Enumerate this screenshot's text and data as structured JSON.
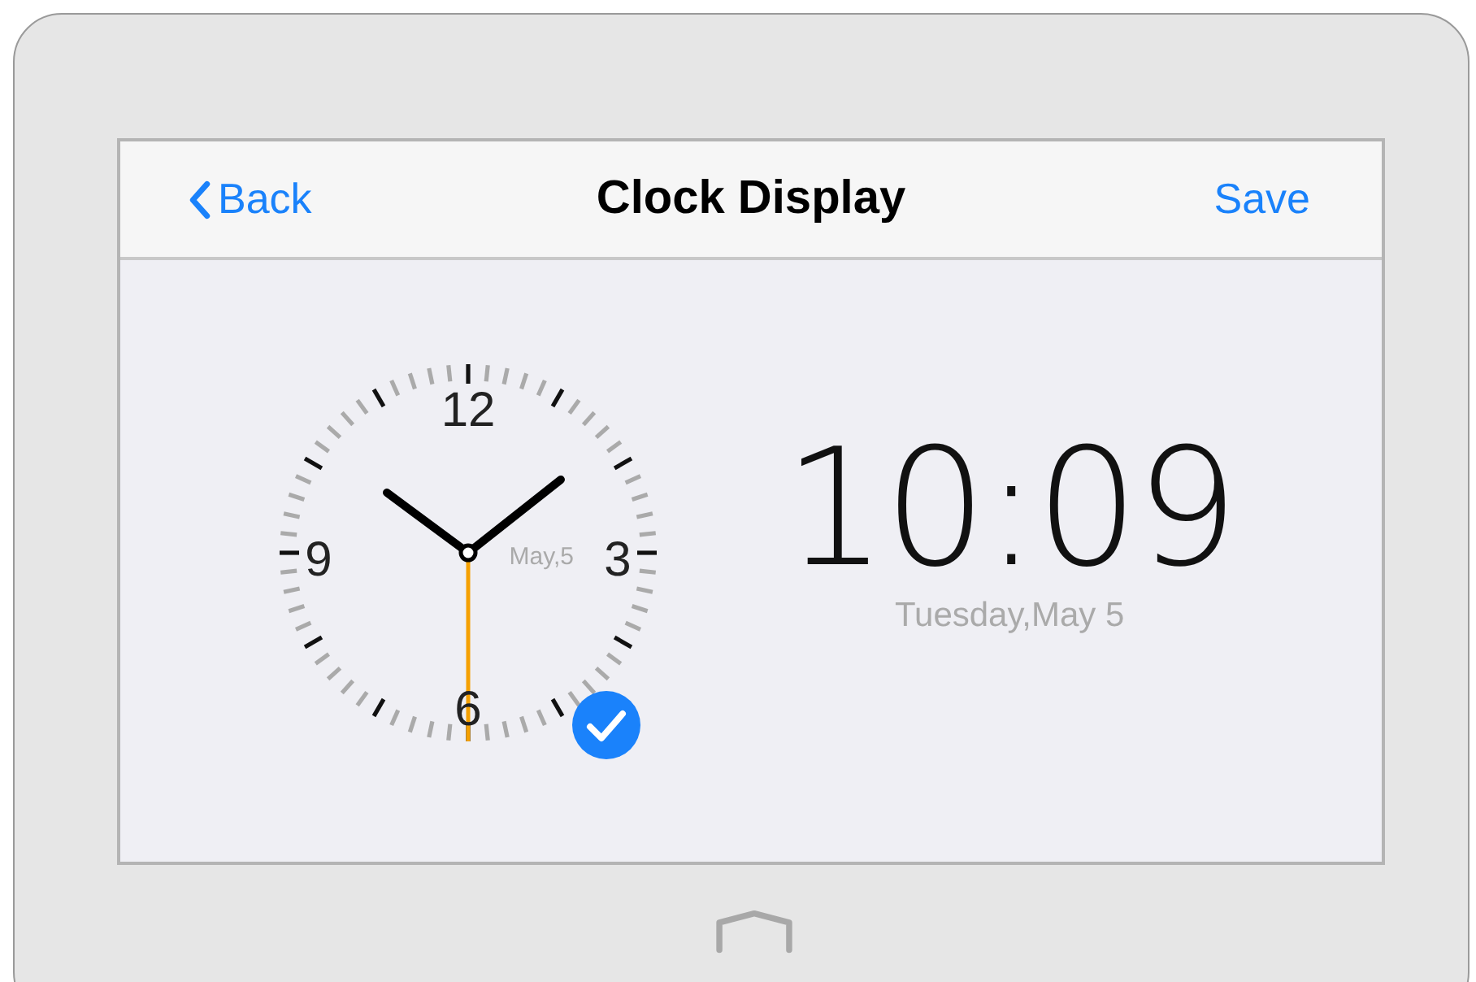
{
  "nav_bar": {
    "back": "Back",
    "title": "Clock Display",
    "save": "Save"
  },
  "analog_clock": {
    "selected": true,
    "numerals": [
      "12",
      "3",
      "6",
      "9"
    ],
    "date": "May,5"
  },
  "digital_clock": {
    "time": "10:09",
    "date": "Tuesday,May 5"
  }
}
